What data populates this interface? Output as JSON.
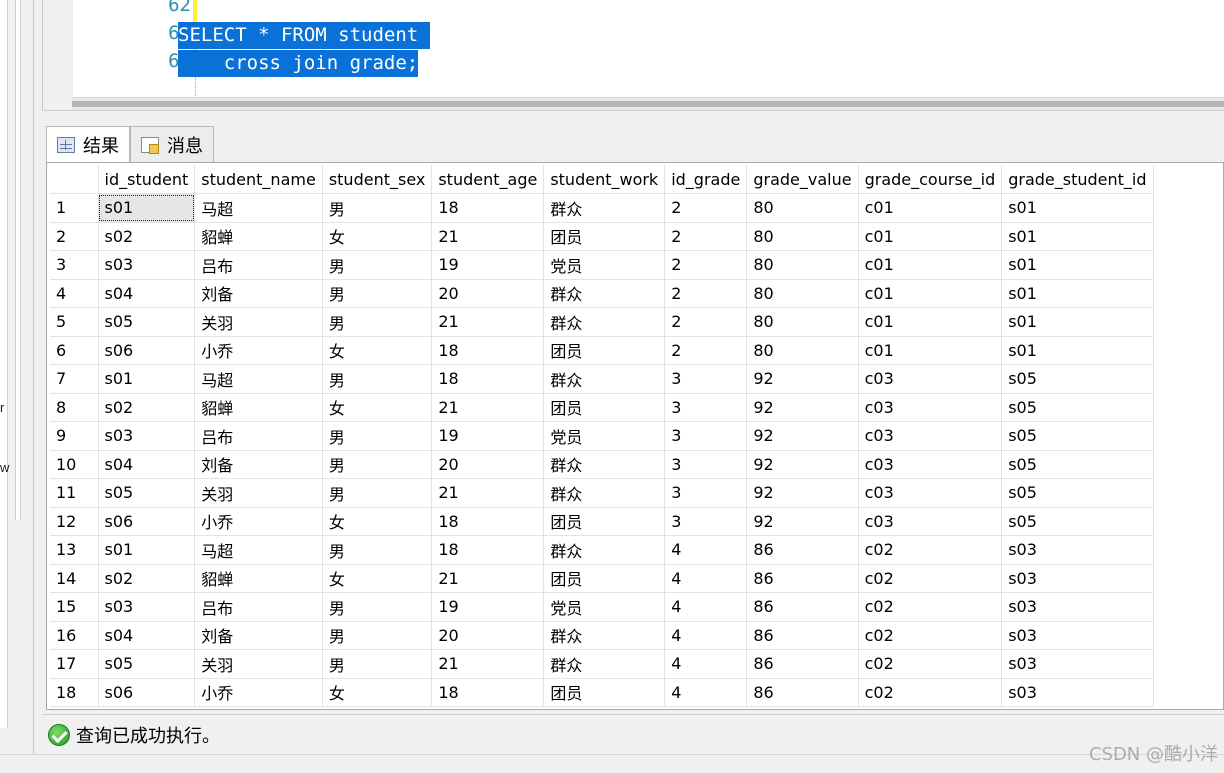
{
  "left_pane": {
    "fragments": [
      "r",
      "w"
    ]
  },
  "editor": {
    "line_numbers": [
      "62",
      "63",
      "64"
    ],
    "code_lines": [
      "SELECT * FROM student ",
      "    cross join grade;"
    ]
  },
  "tabs": [
    {
      "label": "结果",
      "icon": "grid-icon"
    },
    {
      "label": "消息",
      "icon": "message-icon"
    }
  ],
  "results": {
    "columns": [
      "id_student",
      "student_name",
      "student_sex",
      "student_age",
      "student_work",
      "id_grade",
      "grade_value",
      "grade_course_id",
      "grade_student_id"
    ],
    "rows": [
      [
        "1",
        "s01",
        "马超",
        "男",
        "18",
        "群众",
        "2",
        "80",
        "c01",
        "s01"
      ],
      [
        "2",
        "s02",
        "貂蝉",
        "女",
        "21",
        "团员",
        "2",
        "80",
        "c01",
        "s01"
      ],
      [
        "3",
        "s03",
        "吕布",
        "男",
        "19",
        "党员",
        "2",
        "80",
        "c01",
        "s01"
      ],
      [
        "4",
        "s04",
        "刘备",
        "男",
        "20",
        "群众",
        "2",
        "80",
        "c01",
        "s01"
      ],
      [
        "5",
        "s05",
        "关羽",
        "男",
        "21",
        "群众",
        "2",
        "80",
        "c01",
        "s01"
      ],
      [
        "6",
        "s06",
        "小乔",
        "女",
        "18",
        "团员",
        "2",
        "80",
        "c01",
        "s01"
      ],
      [
        "7",
        "s01",
        "马超",
        "男",
        "18",
        "群众",
        "3",
        "92",
        "c03",
        "s05"
      ],
      [
        "8",
        "s02",
        "貂蝉",
        "女",
        "21",
        "团员",
        "3",
        "92",
        "c03",
        "s05"
      ],
      [
        "9",
        "s03",
        "吕布",
        "男",
        "19",
        "党员",
        "3",
        "92",
        "c03",
        "s05"
      ],
      [
        "10",
        "s04",
        "刘备",
        "男",
        "20",
        "群众",
        "3",
        "92",
        "c03",
        "s05"
      ],
      [
        "11",
        "s05",
        "关羽",
        "男",
        "21",
        "群众",
        "3",
        "92",
        "c03",
        "s05"
      ],
      [
        "12",
        "s06",
        "小乔",
        "女",
        "18",
        "团员",
        "3",
        "92",
        "c03",
        "s05"
      ],
      [
        "13",
        "s01",
        "马超",
        "男",
        "18",
        "群众",
        "4",
        "86",
        "c02",
        "s03"
      ],
      [
        "14",
        "s02",
        "貂蝉",
        "女",
        "21",
        "团员",
        "4",
        "86",
        "c02",
        "s03"
      ],
      [
        "15",
        "s03",
        "吕布",
        "男",
        "19",
        "党员",
        "4",
        "86",
        "c02",
        "s03"
      ],
      [
        "16",
        "s04",
        "刘备",
        "男",
        "20",
        "群众",
        "4",
        "86",
        "c02",
        "s03"
      ],
      [
        "17",
        "s05",
        "关羽",
        "男",
        "21",
        "群众",
        "4",
        "86",
        "c02",
        "s03"
      ],
      [
        "18",
        "s06",
        "小乔",
        "女",
        "18",
        "团员",
        "4",
        "86",
        "c02",
        "s03"
      ]
    ]
  },
  "status": {
    "text": "查询已成功执行。",
    "icon": "success-check-icon"
  },
  "watermark": "CSDN @酷小洋",
  "colors": {
    "selection": "#0a71d8",
    "line_number": "#2b91af",
    "modified_marker": "#f7f139"
  }
}
